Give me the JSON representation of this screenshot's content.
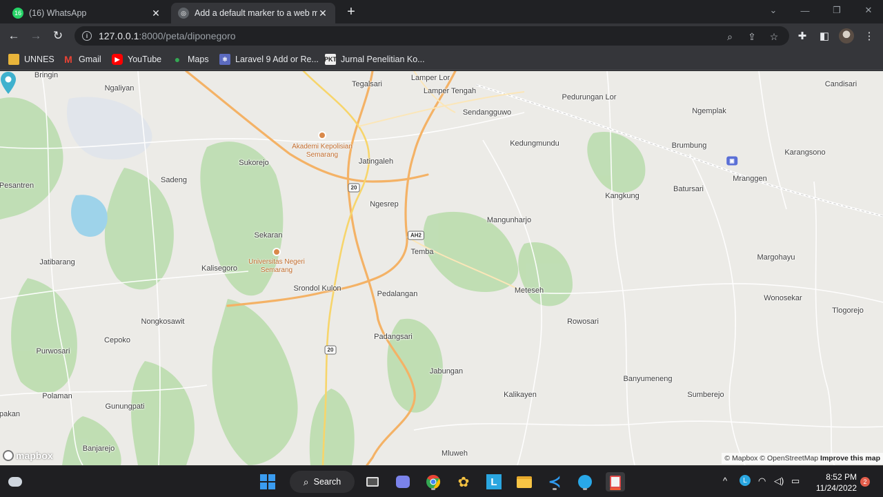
{
  "browser": {
    "tabs": [
      {
        "title": "(16) WhatsApp",
        "badge": "16",
        "close": "✕"
      },
      {
        "title": "Add a default marker to a web m",
        "close": "✕"
      }
    ],
    "new_tab": "+",
    "window_controls": {
      "dropdown": "⌄",
      "minimize": "—",
      "maximize": "❐",
      "close": "✕"
    },
    "address": {
      "host": "127.0.0.1",
      "rest": ":8000/peta/diponegoro"
    },
    "bookmarks": [
      "UNNES",
      "Gmail",
      "YouTube",
      "Maps",
      "Laravel 9 Add or Re...",
      "Jurnal Penelitian Ko..."
    ]
  },
  "map": {
    "places": [
      {
        "name": "Bringin"
      },
      {
        "name": "Ngaliyan"
      },
      {
        "name": "Tegalsari"
      },
      {
        "name": "Lamper Lor"
      },
      {
        "name": "Lamper Tengah"
      },
      {
        "name": "Pedurungan Lor"
      },
      {
        "name": "Candisari"
      },
      {
        "name": "Sendangguwo"
      },
      {
        "name": "Ngemplak"
      },
      {
        "name": "Kedungmundu"
      },
      {
        "name": "Brumbung"
      },
      {
        "name": "Karangsono"
      },
      {
        "name": "Sukorejo"
      },
      {
        "name": "Jatingaleh"
      },
      {
        "name": "Mranggen"
      },
      {
        "name": "Sadeng"
      },
      {
        "name": "Pesantren"
      },
      {
        "name": "Batursari"
      },
      {
        "name": "Kangkung"
      },
      {
        "name": "Ngesrep"
      },
      {
        "name": "Mangunharjo"
      },
      {
        "name": "Sekaran"
      },
      {
        "name": "Temba"
      },
      {
        "name": "Margohayu"
      },
      {
        "name": "Jatibarang"
      },
      {
        "name": "Kalisegoro"
      },
      {
        "name": "Srondol Kulon"
      },
      {
        "name": "Meteseh"
      },
      {
        "name": "Pedalangan"
      },
      {
        "name": "Wonosekar"
      },
      {
        "name": "Tlogorejo"
      },
      {
        "name": "Nongkosawit"
      },
      {
        "name": "Rowosari"
      },
      {
        "name": "Cepoko"
      },
      {
        "name": "Padangsari"
      },
      {
        "name": "Purwosari"
      },
      {
        "name": "Jabungan"
      },
      {
        "name": "Banyumeneng"
      },
      {
        "name": "Polaman"
      },
      {
        "name": "Kalikayen"
      },
      {
        "name": "Sumberejo"
      },
      {
        "name": "Gunungpati"
      },
      {
        "name": "pakan"
      },
      {
        "name": "Banjarejo"
      },
      {
        "name": "Mluweh"
      }
    ],
    "pois": [
      {
        "name": "Akademi Kepolisian\nSemarang"
      },
      {
        "name": "Universitas Negeri\nSemarang"
      }
    ],
    "shields": [
      "20",
      "AH2",
      "20"
    ],
    "attribution": {
      "a": "© Mapbox",
      "b": "© OpenStreetMap",
      "c": "Improve this map"
    },
    "logo": "mapbox"
  },
  "taskbar": {
    "search": "Search",
    "time": "8:52 PM",
    "date": "11/24/2022",
    "notifications": "2"
  }
}
